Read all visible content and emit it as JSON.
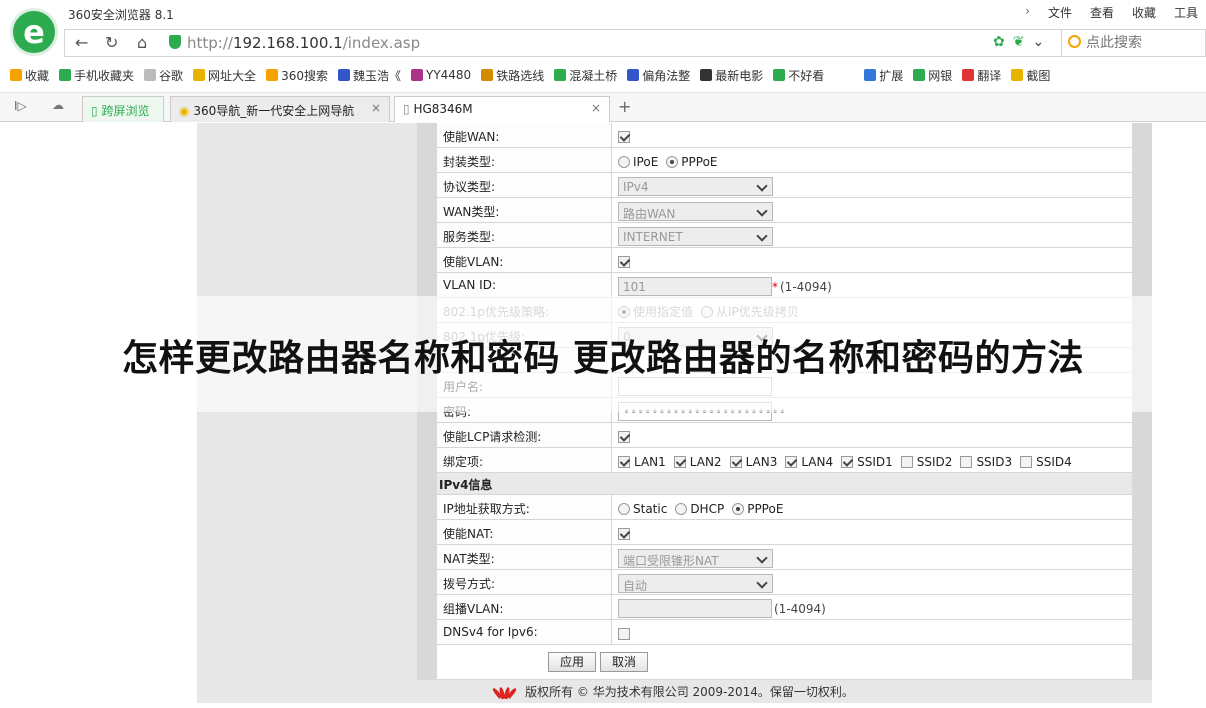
{
  "window": {
    "app_title": "360安全浏览器 8.1",
    "menu": [
      "文件",
      "查看",
      "收藏",
      "工具"
    ],
    "menu_chevron": "›",
    "logo_letter": "e"
  },
  "address_bar": {
    "back_icon": "←",
    "refresh_icon": "↻",
    "home_icon": "⌂",
    "url_prefix": "http://",
    "url_host": "192.168.100.1",
    "url_path": "/index.asp",
    "search_placeholder": "点此搜索",
    "dropdown_icon": "⌄"
  },
  "bookmarks": [
    {
      "label": "收藏",
      "icon": "star-icon",
      "color": "#f5a300"
    },
    {
      "label": "手机收藏夹",
      "icon": "phone-icon",
      "color": "#2dab4f"
    },
    {
      "label": "谷歌",
      "icon": "page-icon",
      "color": "#bbbbbb"
    },
    {
      "label": "网址大全",
      "icon": "globe-icon",
      "color": "#e8b400"
    },
    {
      "label": "360搜索",
      "icon": "search-icon",
      "color": "#f5a300"
    },
    {
      "label": "魏玉浩《",
      "icon": "paw-icon",
      "color": "#3355cc"
    },
    {
      "label": "YY4480",
      "icon": "film-icon",
      "color": "#aa3388"
    },
    {
      "label": "铁路选线",
      "icon": "book-icon",
      "color": "#d48b00"
    },
    {
      "label": "混凝土桥",
      "icon": "leaf-icon",
      "color": "#2dab4f"
    },
    {
      "label": "偏角法整",
      "icon": "paw-icon",
      "color": "#3355cc"
    },
    {
      "label": "最新电影",
      "icon": "film-icon",
      "color": "#333333"
    },
    {
      "label": "不好看",
      "icon": "search-icon",
      "color": "#2dab4f"
    },
    {
      "label": "扩展",
      "icon": "grid-icon",
      "color": "#3377dd"
    },
    {
      "label": "网银",
      "icon": "bank-icon",
      "color": "#2dab4f"
    },
    {
      "label": "翻译",
      "icon": "translate-icon",
      "color": "#dd3333"
    },
    {
      "label": "截图",
      "icon": "scissors-icon",
      "color": "#e8b400"
    }
  ],
  "tabs": {
    "side_label": "跨屏浏览",
    "items": [
      {
        "label": "360导航_新一代安全上网导航",
        "active": false
      },
      {
        "label": "HG8346M",
        "active": true
      }
    ],
    "close_glyph": "×",
    "new_tab_glyph": "+"
  },
  "form": {
    "rows_top": [
      {
        "label": "使能WAN:",
        "type": "checkbox",
        "checked": true
      },
      {
        "label": "封装类型:",
        "type": "radio",
        "options": [
          "IPoE",
          "PPPoE"
        ],
        "selected": "PPPoE"
      },
      {
        "label": "协议类型:",
        "type": "select",
        "value": "IPv4"
      },
      {
        "label": "WAN类型:",
        "type": "select",
        "value": "路由WAN"
      },
      {
        "label": "服务类型:",
        "type": "select",
        "value": "INTERNET"
      },
      {
        "label": "使能VLAN:",
        "type": "checkbox",
        "checked": true
      },
      {
        "label": "VLAN ID:",
        "type": "text",
        "value": "101",
        "hint": "(1-4094)",
        "required_mark": "*"
      },
      {
        "label": "802.1p优先级策略:",
        "type": "radio",
        "options": [
          "使用指定值",
          "从IP优先级拷贝"
        ],
        "selected": "使用指定值",
        "disabled": true
      },
      {
        "label": "802.1p优先级:",
        "type": "select",
        "value": "0",
        "disabled": true
      },
      {
        "label": "",
        "type": "blank"
      },
      {
        "label": "用户名:",
        "type": "text_white",
        "value": ""
      },
      {
        "label": "密码:",
        "type": "text_white",
        "value": "•••••••••••••••••••••••"
      },
      {
        "label": "使能LCP请求检测:",
        "type": "checkbox",
        "checked": true
      }
    ],
    "bind_label": "绑定项:",
    "bind_items": [
      {
        "label": "LAN1",
        "checked": true
      },
      {
        "label": "LAN2",
        "checked": true
      },
      {
        "label": "LAN3",
        "checked": true
      },
      {
        "label": "LAN4",
        "checked": true
      },
      {
        "label": "SSID1",
        "checked": true
      },
      {
        "label": "SSID2",
        "checked": false
      },
      {
        "label": "SSID3",
        "checked": false
      },
      {
        "label": "SSID4",
        "checked": false
      }
    ],
    "section_ipv4": "IPv4信息",
    "rows_ipv4": [
      {
        "label": "IP地址获取方式:",
        "type": "radio",
        "options": [
          "Static",
          "DHCP",
          "PPPoE"
        ],
        "selected": "PPPoE"
      },
      {
        "label": "使能NAT:",
        "type": "checkbox",
        "checked": true
      },
      {
        "label": "NAT类型:",
        "type": "select",
        "value": "端口受限锥形NAT"
      },
      {
        "label": "拨号方式:",
        "type": "select",
        "value": "自动"
      },
      {
        "label": "组播VLAN:",
        "type": "text",
        "value": "",
        "hint": "(1-4094)"
      },
      {
        "label": "DNSv4 for Ipv6:",
        "type": "checkbox",
        "checked": false
      }
    ],
    "apply_label": "应用",
    "cancel_label": "取消"
  },
  "footer": {
    "text": "版权所有 © 华为技术有限公司 2009-2014。保留一切权利。",
    "logo_color": "#dd2222"
  },
  "overlay": {
    "headline": "怎样更改路由器名称和密码 更改路由器的名称和密码的方法"
  },
  "colors": {
    "brand_green": "#2dab4f",
    "search_orange": "#f5a300"
  }
}
